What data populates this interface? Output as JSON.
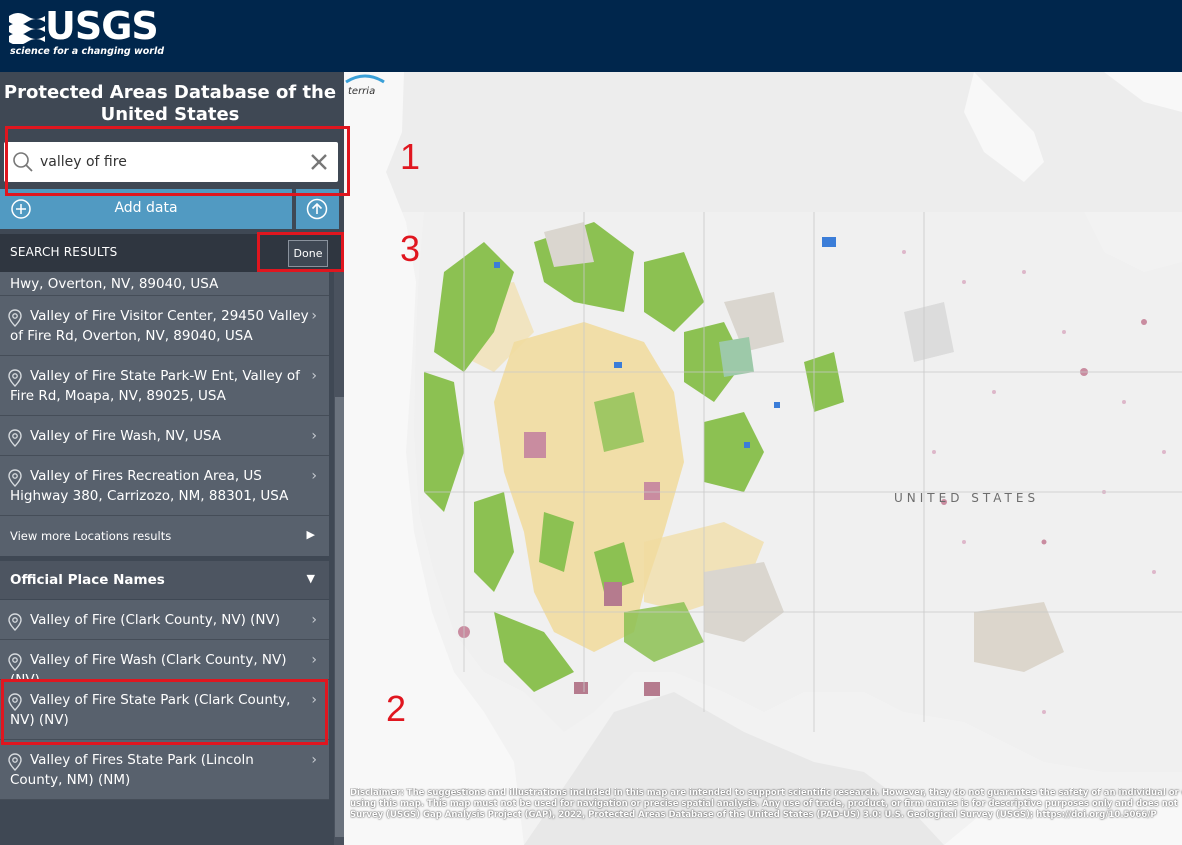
{
  "header": {
    "logo_text": "USGS",
    "logo_tagline": "science for a changing world"
  },
  "sidebar": {
    "title": "Protected Areas Database of the United States",
    "search": {
      "value": "valley of fire",
      "clear_icon": "close-icon"
    },
    "add_data_label": "Add data",
    "results_header": "SEARCH RESULTS",
    "done_label": "Done",
    "location_results": [
      "Hwy, Overton, NV, 89040, USA",
      "Valley of Fire Visitor Center, 29450 Valley of Fire Rd, Overton, NV, 89040, USA",
      "Valley of Fire State Park-W Ent, Valley of Fire Rd, Moapa, NV, 89025, USA",
      "Valley of Fire Wash, NV, USA",
      "Valley of Fires Recreation Area, US Highway 380, Carrizozo, NM, 88301, USA"
    ],
    "view_more_label": "View more Locations results",
    "official_section_title": "Official Place Names",
    "official_results": [
      "Valley of Fire (Clark County, NV) (NV)",
      "Valley of Fire Wash (Clark County, NV) (NV)",
      "Valley of Fire State Park (Clark County, NV) (NV)",
      "Valley of Fires State Park (Lincoln County, NM) (NM)"
    ]
  },
  "map": {
    "country_label": "UNITED STATES",
    "attribution_logo": "terria",
    "disclaimer_line1": "Disclaimer: The suggestions and illustrations included in this map are intended to support scientific research. However, they do not guarantee the safety of an individual or c",
    "disclaimer_line2": "using this map. This map must not be used for navigation or precise spatial analysis. Any use of trade, product, or firm names is for descriptive purposes only and does not",
    "disclaimer_line3": "Survey (USGS) Gap Analysis Project (GAP), 2022, Protected Areas Database of the United States (PAD-US) 3.0: U.S. Geological Survey (USGS); https://doi.org/10.5066/P"
  },
  "annotations": {
    "labels": [
      "1",
      "2",
      "3"
    ],
    "color": "#e0161f"
  },
  "colors": {
    "header_bg": "#00264c",
    "sidebar_bg": "#3f4854",
    "accent": "#519ac2",
    "federal_green": "#8cc152",
    "blm_tan": "#f1dca0"
  }
}
